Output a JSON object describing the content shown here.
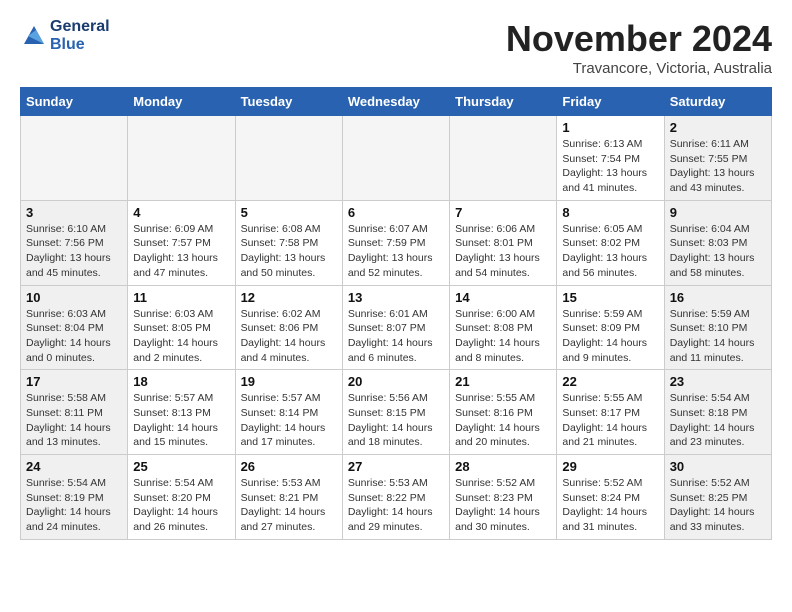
{
  "logo": {
    "line1": "General",
    "line2": "Blue"
  },
  "title": "November 2024",
  "subtitle": "Travancore, Victoria, Australia",
  "headers": [
    "Sunday",
    "Monday",
    "Tuesday",
    "Wednesday",
    "Thursday",
    "Friday",
    "Saturday"
  ],
  "weeks": [
    [
      {
        "day": "",
        "info": "",
        "empty": true
      },
      {
        "day": "",
        "info": "",
        "empty": true
      },
      {
        "day": "",
        "info": "",
        "empty": true
      },
      {
        "day": "",
        "info": "",
        "empty": true
      },
      {
        "day": "",
        "info": "",
        "empty": true
      },
      {
        "day": "1",
        "info": "Sunrise: 6:13 AM\nSunset: 7:54 PM\nDaylight: 13 hours\nand 41 minutes.",
        "shaded": false
      },
      {
        "day": "2",
        "info": "Sunrise: 6:11 AM\nSunset: 7:55 PM\nDaylight: 13 hours\nand 43 minutes.",
        "shaded": true
      }
    ],
    [
      {
        "day": "3",
        "info": "Sunrise: 6:10 AM\nSunset: 7:56 PM\nDaylight: 13 hours\nand 45 minutes.",
        "shaded": true
      },
      {
        "day": "4",
        "info": "Sunrise: 6:09 AM\nSunset: 7:57 PM\nDaylight: 13 hours\nand 47 minutes.",
        "shaded": false
      },
      {
        "day": "5",
        "info": "Sunrise: 6:08 AM\nSunset: 7:58 PM\nDaylight: 13 hours\nand 50 minutes.",
        "shaded": false
      },
      {
        "day": "6",
        "info": "Sunrise: 6:07 AM\nSunset: 7:59 PM\nDaylight: 13 hours\nand 52 minutes.",
        "shaded": false
      },
      {
        "day": "7",
        "info": "Sunrise: 6:06 AM\nSunset: 8:01 PM\nDaylight: 13 hours\nand 54 minutes.",
        "shaded": false
      },
      {
        "day": "8",
        "info": "Sunrise: 6:05 AM\nSunset: 8:02 PM\nDaylight: 13 hours\nand 56 minutes.",
        "shaded": false
      },
      {
        "day": "9",
        "info": "Sunrise: 6:04 AM\nSunset: 8:03 PM\nDaylight: 13 hours\nand 58 minutes.",
        "shaded": true
      }
    ],
    [
      {
        "day": "10",
        "info": "Sunrise: 6:03 AM\nSunset: 8:04 PM\nDaylight: 14 hours\nand 0 minutes.",
        "shaded": true
      },
      {
        "day": "11",
        "info": "Sunrise: 6:03 AM\nSunset: 8:05 PM\nDaylight: 14 hours\nand 2 minutes.",
        "shaded": false
      },
      {
        "day": "12",
        "info": "Sunrise: 6:02 AM\nSunset: 8:06 PM\nDaylight: 14 hours\nand 4 minutes.",
        "shaded": false
      },
      {
        "day": "13",
        "info": "Sunrise: 6:01 AM\nSunset: 8:07 PM\nDaylight: 14 hours\nand 6 minutes.",
        "shaded": false
      },
      {
        "day": "14",
        "info": "Sunrise: 6:00 AM\nSunset: 8:08 PM\nDaylight: 14 hours\nand 8 minutes.",
        "shaded": false
      },
      {
        "day": "15",
        "info": "Sunrise: 5:59 AM\nSunset: 8:09 PM\nDaylight: 14 hours\nand 9 minutes.",
        "shaded": false
      },
      {
        "day": "16",
        "info": "Sunrise: 5:59 AM\nSunset: 8:10 PM\nDaylight: 14 hours\nand 11 minutes.",
        "shaded": true
      }
    ],
    [
      {
        "day": "17",
        "info": "Sunrise: 5:58 AM\nSunset: 8:11 PM\nDaylight: 14 hours\nand 13 minutes.",
        "shaded": true
      },
      {
        "day": "18",
        "info": "Sunrise: 5:57 AM\nSunset: 8:13 PM\nDaylight: 14 hours\nand 15 minutes.",
        "shaded": false
      },
      {
        "day": "19",
        "info": "Sunrise: 5:57 AM\nSunset: 8:14 PM\nDaylight: 14 hours\nand 17 minutes.",
        "shaded": false
      },
      {
        "day": "20",
        "info": "Sunrise: 5:56 AM\nSunset: 8:15 PM\nDaylight: 14 hours\nand 18 minutes.",
        "shaded": false
      },
      {
        "day": "21",
        "info": "Sunrise: 5:55 AM\nSunset: 8:16 PM\nDaylight: 14 hours\nand 20 minutes.",
        "shaded": false
      },
      {
        "day": "22",
        "info": "Sunrise: 5:55 AM\nSunset: 8:17 PM\nDaylight: 14 hours\nand 21 minutes.",
        "shaded": false
      },
      {
        "day": "23",
        "info": "Sunrise: 5:54 AM\nSunset: 8:18 PM\nDaylight: 14 hours\nand 23 minutes.",
        "shaded": true
      }
    ],
    [
      {
        "day": "24",
        "info": "Sunrise: 5:54 AM\nSunset: 8:19 PM\nDaylight: 14 hours\nand 24 minutes.",
        "shaded": true
      },
      {
        "day": "25",
        "info": "Sunrise: 5:54 AM\nSunset: 8:20 PM\nDaylight: 14 hours\nand 26 minutes.",
        "shaded": false
      },
      {
        "day": "26",
        "info": "Sunrise: 5:53 AM\nSunset: 8:21 PM\nDaylight: 14 hours\nand 27 minutes.",
        "shaded": false
      },
      {
        "day": "27",
        "info": "Sunrise: 5:53 AM\nSunset: 8:22 PM\nDaylight: 14 hours\nand 29 minutes.",
        "shaded": false
      },
      {
        "day": "28",
        "info": "Sunrise: 5:52 AM\nSunset: 8:23 PM\nDaylight: 14 hours\nand 30 minutes.",
        "shaded": false
      },
      {
        "day": "29",
        "info": "Sunrise: 5:52 AM\nSunset: 8:24 PM\nDaylight: 14 hours\nand 31 minutes.",
        "shaded": false
      },
      {
        "day": "30",
        "info": "Sunrise: 5:52 AM\nSunset: 8:25 PM\nDaylight: 14 hours\nand 33 minutes.",
        "shaded": true
      }
    ]
  ]
}
